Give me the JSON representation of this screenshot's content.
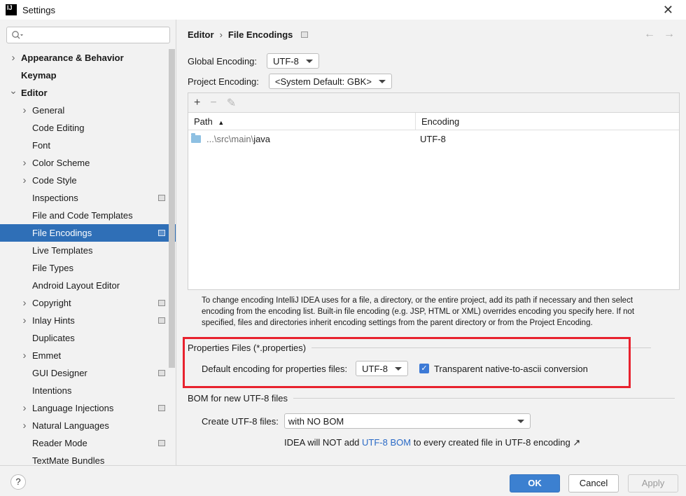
{
  "window": {
    "title": "Settings",
    "logo_text": "IJ"
  },
  "sidebar": {
    "search": {
      "placeholder": ""
    },
    "items": [
      {
        "label": "Appearance & Behavior",
        "level": 0,
        "chevron": "right",
        "selected": false,
        "project_icon": false
      },
      {
        "label": "Keymap",
        "level": 0,
        "chevron": "none",
        "selected": false,
        "project_icon": false
      },
      {
        "label": "Editor",
        "level": 0,
        "chevron": "down",
        "selected": false,
        "project_icon": false
      },
      {
        "label": "General",
        "level": 1,
        "chevron": "right",
        "selected": false,
        "project_icon": false
      },
      {
        "label": "Code Editing",
        "level": 1,
        "chevron": "none",
        "selected": false,
        "project_icon": false
      },
      {
        "label": "Font",
        "level": 1,
        "chevron": "none",
        "selected": false,
        "project_icon": false
      },
      {
        "label": "Color Scheme",
        "level": 1,
        "chevron": "right",
        "selected": false,
        "project_icon": false
      },
      {
        "label": "Code Style",
        "level": 1,
        "chevron": "right",
        "selected": false,
        "project_icon": false
      },
      {
        "label": "Inspections",
        "level": 1,
        "chevron": "none",
        "selected": false,
        "project_icon": true
      },
      {
        "label": "File and Code Templates",
        "level": 1,
        "chevron": "none",
        "selected": false,
        "project_icon": false
      },
      {
        "label": "File Encodings",
        "level": 1,
        "chevron": "none",
        "selected": true,
        "project_icon": true
      },
      {
        "label": "Live Templates",
        "level": 1,
        "chevron": "none",
        "selected": false,
        "project_icon": false
      },
      {
        "label": "File Types",
        "level": 1,
        "chevron": "none",
        "selected": false,
        "project_icon": false
      },
      {
        "label": "Android Layout Editor",
        "level": 1,
        "chevron": "none",
        "selected": false,
        "project_icon": false
      },
      {
        "label": "Copyright",
        "level": 1,
        "chevron": "right",
        "selected": false,
        "project_icon": true
      },
      {
        "label": "Inlay Hints",
        "level": 1,
        "chevron": "right",
        "selected": false,
        "project_icon": true
      },
      {
        "label": "Duplicates",
        "level": 1,
        "chevron": "none",
        "selected": false,
        "project_icon": false
      },
      {
        "label": "Emmet",
        "level": 1,
        "chevron": "right",
        "selected": false,
        "project_icon": false
      },
      {
        "label": "GUI Designer",
        "level": 1,
        "chevron": "none",
        "selected": false,
        "project_icon": true
      },
      {
        "label": "Intentions",
        "level": 1,
        "chevron": "none",
        "selected": false,
        "project_icon": false
      },
      {
        "label": "Language Injections",
        "level": 1,
        "chevron": "right",
        "selected": false,
        "project_icon": true
      },
      {
        "label": "Natural Languages",
        "level": 1,
        "chevron": "right",
        "selected": false,
        "project_icon": false
      },
      {
        "label": "Reader Mode",
        "level": 1,
        "chevron": "none",
        "selected": false,
        "project_icon": true
      },
      {
        "label": "TextMate Bundles",
        "level": 1,
        "chevron": "none",
        "selected": false,
        "project_icon": false
      }
    ]
  },
  "breadcrumb": {
    "parent": "Editor",
    "separator": "›",
    "current": "File Encodings"
  },
  "global_encoding": {
    "label": "Global Encoding:",
    "value": "UTF-8"
  },
  "project_encoding": {
    "label": "Project Encoding:",
    "value": "<System Default: GBK>"
  },
  "table": {
    "toolbar": {
      "add": "+",
      "remove": "−",
      "edit": "✎"
    },
    "columns": {
      "path": "Path",
      "path_sort": "▲",
      "encoding": "Encoding"
    },
    "rows": [
      {
        "path_prefix": "...\\src\\main\\",
        "path_name": "java",
        "encoding": "UTF-8"
      }
    ]
  },
  "help_text": "To change encoding IntelliJ IDEA uses for a file, a directory, or the entire project, add its path if necessary and then select encoding from the encoding list. Built-in file encoding (e.g. JSP, HTML or XML) overrides encoding you specify here. If not specified, files and directories inherit encoding settings from the parent directory or from the Project Encoding.",
  "properties": {
    "title": "Properties Files (*.properties)",
    "default_label": "Default encoding for properties files:",
    "default_value": "UTF-8",
    "transparent_label": "Transparent native-to-ascii conversion",
    "transparent_checked": true
  },
  "bom": {
    "title": "BOM for new UTF-8 files",
    "create_label": "Create UTF-8 files:",
    "create_value": "with NO BOM",
    "note_prefix": "IDEA will NOT add ",
    "note_link": "UTF-8 BOM",
    "note_suffix": " to every created file in UTF-8 encoding ↗"
  },
  "footer": {
    "help": "?",
    "ok": "OK",
    "cancel": "Cancel",
    "apply": "Apply"
  },
  "colors": {
    "selection": "#2f6fb7",
    "ok_button": "#3c80d0",
    "highlight_box": "#e8222e",
    "link": "#2a6ac6"
  }
}
